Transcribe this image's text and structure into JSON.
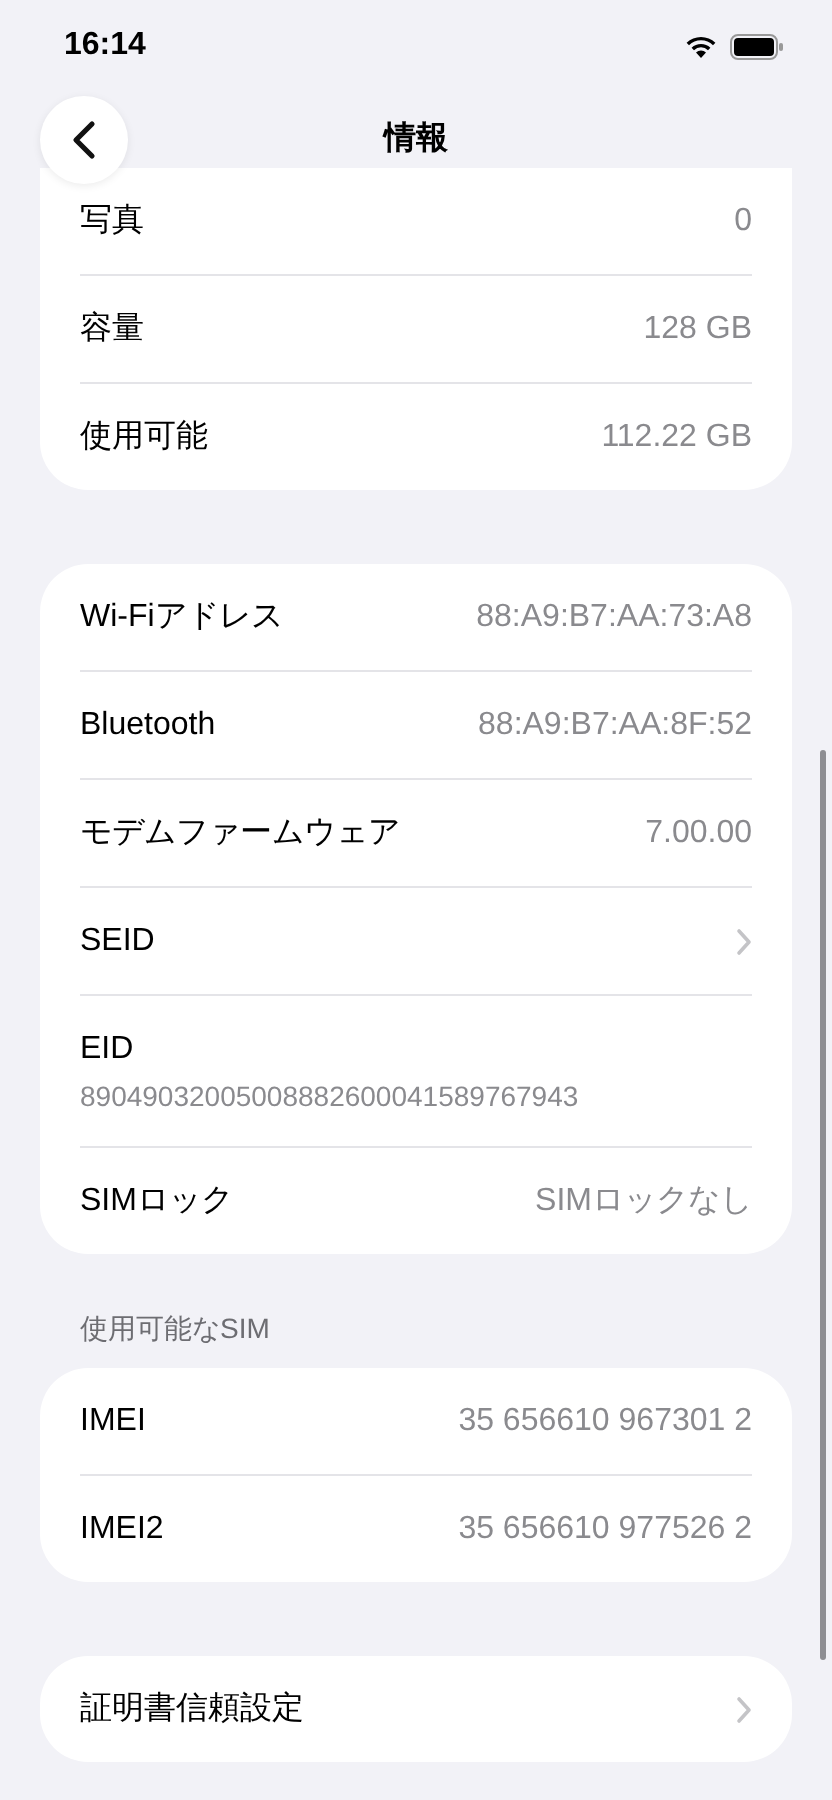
{
  "status_bar": {
    "time": "16:14"
  },
  "nav": {
    "title": "情報"
  },
  "sections": [
    {
      "rows": [
        {
          "kind": "value",
          "label": "写真",
          "value": "0"
        },
        {
          "kind": "value",
          "label": "容量",
          "value": "128 GB"
        },
        {
          "kind": "value",
          "label": "使用可能",
          "value": "112.22 GB"
        }
      ]
    },
    {
      "rows": [
        {
          "kind": "value",
          "label": "Wi-Fiアドレス",
          "value": "88:A9:B7:AA:73:A8"
        },
        {
          "kind": "value",
          "label": "Bluetooth",
          "value": "88:A9:B7:AA:8F:52"
        },
        {
          "kind": "value",
          "label": "モデムファームウェア",
          "value": "7.00.00"
        },
        {
          "kind": "link",
          "label": "SEID"
        },
        {
          "kind": "stacked",
          "label": "EID",
          "value": "89049032005008882600041589767943"
        },
        {
          "kind": "value",
          "label": "SIMロック",
          "value": "SIMロックなし"
        }
      ]
    },
    {
      "header": "使用可能なSIM",
      "rows": [
        {
          "kind": "value",
          "label": "IMEI",
          "value": "35 656610 967301 2"
        },
        {
          "kind": "value",
          "label": "IMEI2",
          "value": "35 656610 977526 2"
        }
      ]
    },
    {
      "rows": [
        {
          "kind": "link",
          "label": "証明書信頼設定"
        }
      ]
    }
  ]
}
